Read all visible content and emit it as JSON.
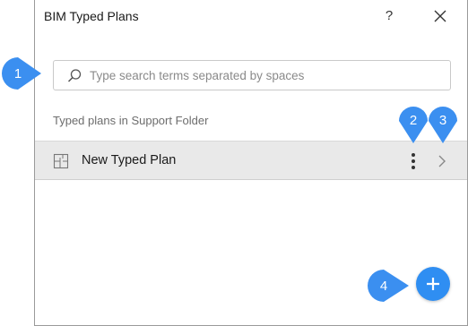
{
  "window": {
    "title": "BIM Typed Plans",
    "help_label": "?"
  },
  "search": {
    "placeholder": "Type search terms separated by spaces"
  },
  "section": {
    "label": "Typed plans in Support Folder"
  },
  "plans": [
    {
      "name": "New Typed Plan"
    }
  ],
  "callouts": [
    "1",
    "2",
    "3",
    "4"
  ],
  "colors": {
    "accent": "#2f8ef2",
    "callout": "#3b8ff0",
    "row_background": "#e9e9e9"
  },
  "icons": {
    "search": "magnifier-icon",
    "close": "close-icon",
    "plan": "floor-plan-icon",
    "more": "vertical-dots-icon",
    "open": "chevron-right-icon",
    "add": "plus-icon"
  }
}
